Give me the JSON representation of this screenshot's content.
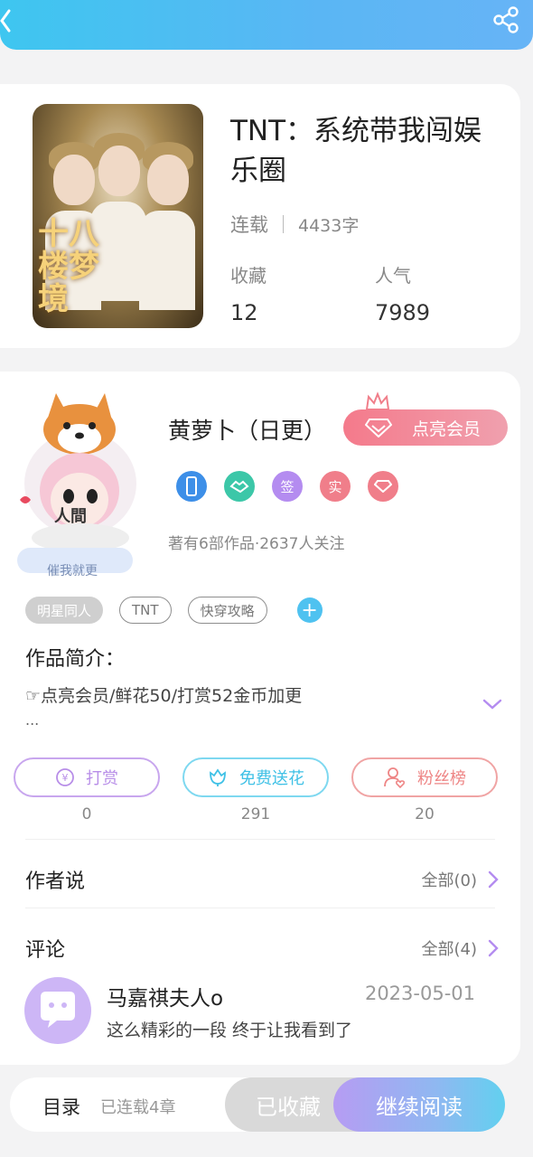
{
  "header": {
    "bg_color": "#4cbdf2",
    "back_icon": "chevron-left-icon",
    "share_icon": "share-icon"
  },
  "book": {
    "cover_text": "十八楼梦境",
    "title": "TNT：系统带我闯娱乐圈",
    "status": "连载",
    "word_count": "4433字",
    "favorites_label": "收藏",
    "favorites_value": "12",
    "popularity_label": "人气",
    "popularity_value": "7989"
  },
  "author": {
    "avatar_caption": "人間",
    "urge_label": "催我就更",
    "nickname": "黄萝卜（日更）",
    "vip_button": "点亮会员",
    "badges": [
      {
        "icon": "phone-badge-icon",
        "text": "",
        "color": "#3d8fe8"
      },
      {
        "icon": "handshake-badge-icon",
        "text": "",
        "color": "#3cc7a8"
      },
      {
        "icon": "sign-badge-icon",
        "text": "签",
        "color": "#b48cf0"
      },
      {
        "icon": "real-badge-icon",
        "text": "实",
        "color": "#f07e8a"
      },
      {
        "icon": "diamond-badge-icon",
        "text": "",
        "color": "#f07e8a"
      }
    ],
    "stats_text": "著有6部作品·2637人关注"
  },
  "tags": [
    "明星同人",
    "TNT",
    "快穿攻略"
  ],
  "intro": {
    "title": "作品简介：",
    "text": "☞点亮会员/鲜花50/打赏52金币加更",
    "ellipsis": "..."
  },
  "actions": [
    {
      "label": "打赏",
      "count": "0",
      "color": "#b88ee8",
      "icon": "yen-icon"
    },
    {
      "label": "免费送花",
      "count": "291",
      "color": "#4cc9ea",
      "icon": "flower-icon"
    },
    {
      "label": "粉丝榜",
      "count": "20",
      "color": "#ee8585",
      "icon": "fans-icon"
    }
  ],
  "author_says": {
    "title": "作者说",
    "link": "全部(0)"
  },
  "comments": {
    "title": "评论",
    "link": "全部(4)",
    "items": [
      {
        "name": "马嘉祺夫人o",
        "date": "2023-05-01",
        "text": "这么精彩的一段 终于让我看到了"
      }
    ]
  },
  "bottom_bar": {
    "toc_label": "目录",
    "toc_count": "已连载4章",
    "collected_label": "已收藏",
    "read_label": "继续阅读"
  }
}
